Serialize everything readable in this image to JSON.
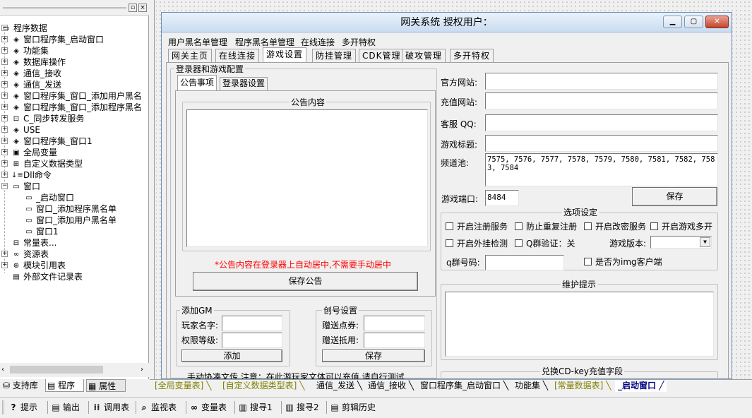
{
  "left_panel": {
    "tree": [
      {
        "label": "程序数据",
        "icon": "folder-open-icon",
        "glyph": "▭",
        "exp": "−",
        "level": 0
      },
      {
        "label": "窗口程序集_启动窗口",
        "icon": "module-icon",
        "glyph": "◈",
        "exp": "+",
        "level": 1
      },
      {
        "label": "功能集",
        "icon": "module-icon",
        "glyph": "◈",
        "exp": "+",
        "level": 1
      },
      {
        "label": "数据库操作",
        "icon": "module-icon",
        "glyph": "◈",
        "exp": "+",
        "level": 1
      },
      {
        "label": "通信_接收",
        "icon": "module-icon",
        "glyph": "◈",
        "exp": "+",
        "level": 1
      },
      {
        "label": "通信_发送",
        "icon": "module-icon",
        "glyph": "◈",
        "exp": "+",
        "level": 1
      },
      {
        "label": "窗口程序集_窗口_添加用户黑名",
        "icon": "module-icon",
        "glyph": "◈",
        "exp": "+",
        "level": 1
      },
      {
        "label": "窗口程序集_窗口_添加程序黑名",
        "icon": "module-icon",
        "glyph": "◈",
        "exp": "+",
        "level": 1
      },
      {
        "label": "C_同步转发服务",
        "icon": "class-icon",
        "glyph": "⊡",
        "exp": "+",
        "level": 1
      },
      {
        "label": "USE",
        "icon": "module-icon",
        "glyph": "◈",
        "exp": "+",
        "level": 1
      },
      {
        "label": "窗口程序集_窗口1",
        "icon": "module-icon",
        "glyph": "◈",
        "exp": "+",
        "level": 1
      },
      {
        "label": "全局变量",
        "icon": "global-var-icon",
        "glyph": "▣",
        "exp": "+",
        "level": 1
      },
      {
        "label": "自定义数据类型",
        "icon": "datatype-icon",
        "glyph": "⊞",
        "exp": "+",
        "level": 1
      },
      {
        "label": "Dll命令",
        "icon": "dll-command-icon",
        "glyph": "↓≡",
        "exp": "+",
        "level": 1
      },
      {
        "label": "窗口",
        "icon": "window-folder-icon",
        "glyph": "▭",
        "exp": "−",
        "level": 1
      },
      {
        "label": "_启动窗口",
        "icon": "window-icon",
        "glyph": "▭",
        "exp": "",
        "level": 2
      },
      {
        "label": "窗口_添加程序黑名单",
        "icon": "window-icon",
        "glyph": "▭",
        "exp": "",
        "level": 2
      },
      {
        "label": "窗口_添加用户黑名单",
        "icon": "window-icon",
        "glyph": "▭",
        "exp": "",
        "level": 2
      },
      {
        "label": "窗口1",
        "icon": "window-icon",
        "glyph": "▭",
        "exp": "",
        "level": 2
      },
      {
        "label": "常量表...",
        "icon": "constant-icon",
        "glyph": "⊟",
        "exp": "",
        "level": 1
      },
      {
        "label": "资源表",
        "icon": "resource-icon",
        "glyph": "∞",
        "exp": "+",
        "level": 1
      },
      {
        "label": "模块引用表",
        "icon": "module-ref-icon",
        "glyph": "⊕",
        "exp": "+",
        "level": 1
      },
      {
        "label": "外部文件记录表",
        "icon": "file-record-icon",
        "glyph": "▤",
        "exp": "",
        "level": 1
      }
    ],
    "tabs": [
      {
        "label": "支持库",
        "icon": "library-icon"
      },
      {
        "label": "程序",
        "icon": "program-icon"
      },
      {
        "label": "属性",
        "icon": "property-icon"
      }
    ]
  },
  "window": {
    "title": "网关系统  授权用户：",
    "menu": [
      "用户黑名单管理",
      "程序黑名单管理",
      "在线连接",
      "多开特权"
    ],
    "tabs": [
      "网关主页",
      "在线连接",
      "游戏设置",
      "防挂管理",
      "CDK管理",
      "破攻管理",
      "多开特权"
    ],
    "selected_tab_index": 2,
    "login_group_title": "登录器和游戏配置",
    "subtabs": [
      "公告事项",
      "登录器设置"
    ],
    "notice_group_title": "公告内容",
    "notice_warning": "*公告内容在登录器上自动居中,不需要手动居中",
    "save_notice_btn": "保存公告",
    "add_gm": {
      "title": "添加GM",
      "player_label": "玩家名字:",
      "level_label": "权限等级:",
      "add_btn": "添加"
    },
    "recharge": {
      "title": "创号设置",
      "points_label": "赠送点券:",
      "offset_label": "赠送抵用:",
      "save_btn": "保存"
    },
    "bottom_text": "手动协凑文传  注意：在此游玩家文体可以充值 请自行测试",
    "right": {
      "official_label": "官方网站:",
      "recharge_label": "充值网站:",
      "qq_label": "客服 QQ:",
      "game_title_label": "游戏标题:",
      "channel_label": "频道池:",
      "channel_value": "7575, 7576, 7577, 7578, 7579, 7580, 7581, 7582, 7583, 7584",
      "port_label": "游戏端口:",
      "port_value": "8484",
      "save_btn": "保存"
    },
    "options": {
      "title": "选项设定",
      "checks": [
        "开启注册服务",
        "防止重复注册",
        "开启改密服务",
        "开启游戏多开",
        "开启外挂检测",
        "Q群验证：关"
      ],
      "version_label": "游戏版本:",
      "qq_group_label": "q群号码:",
      "img_client_label": "是否为img客户端"
    },
    "maintenance_title": "维护提示",
    "cdkey_title": "兑换CD-key充值字段"
  },
  "doc_tabs": [
    "[全局变量表]",
    "[自定义数据类型表]",
    "通信_发送",
    "通信_接收",
    "窗口程序集_启动窗口",
    "功能集",
    "[常量数据表]",
    "_启动窗口"
  ],
  "toolbar": [
    {
      "label": "提示",
      "icon": "hint-icon",
      "glyph": "?"
    },
    {
      "label": "输出",
      "icon": "output-icon",
      "glyph": "▤"
    },
    {
      "label": "调用表",
      "icon": "callstack-icon",
      "glyph": "⁞⁞"
    },
    {
      "label": "监视表",
      "icon": "watch-icon",
      "glyph": "⌕"
    },
    {
      "label": "变量表",
      "icon": "variable-icon",
      "glyph": "∞"
    },
    {
      "label": "搜寻1",
      "icon": "search1-icon",
      "glyph": "▥"
    },
    {
      "label": "搜寻2",
      "icon": "search2-icon",
      "glyph": "▥"
    },
    {
      "label": "剪辑历史",
      "icon": "clip-history-icon",
      "glyph": "▤"
    }
  ],
  "colors": {
    "warning": "#ff0000",
    "doc_tab_bracket": "#808000",
    "active_doc_tab": "#000080"
  }
}
